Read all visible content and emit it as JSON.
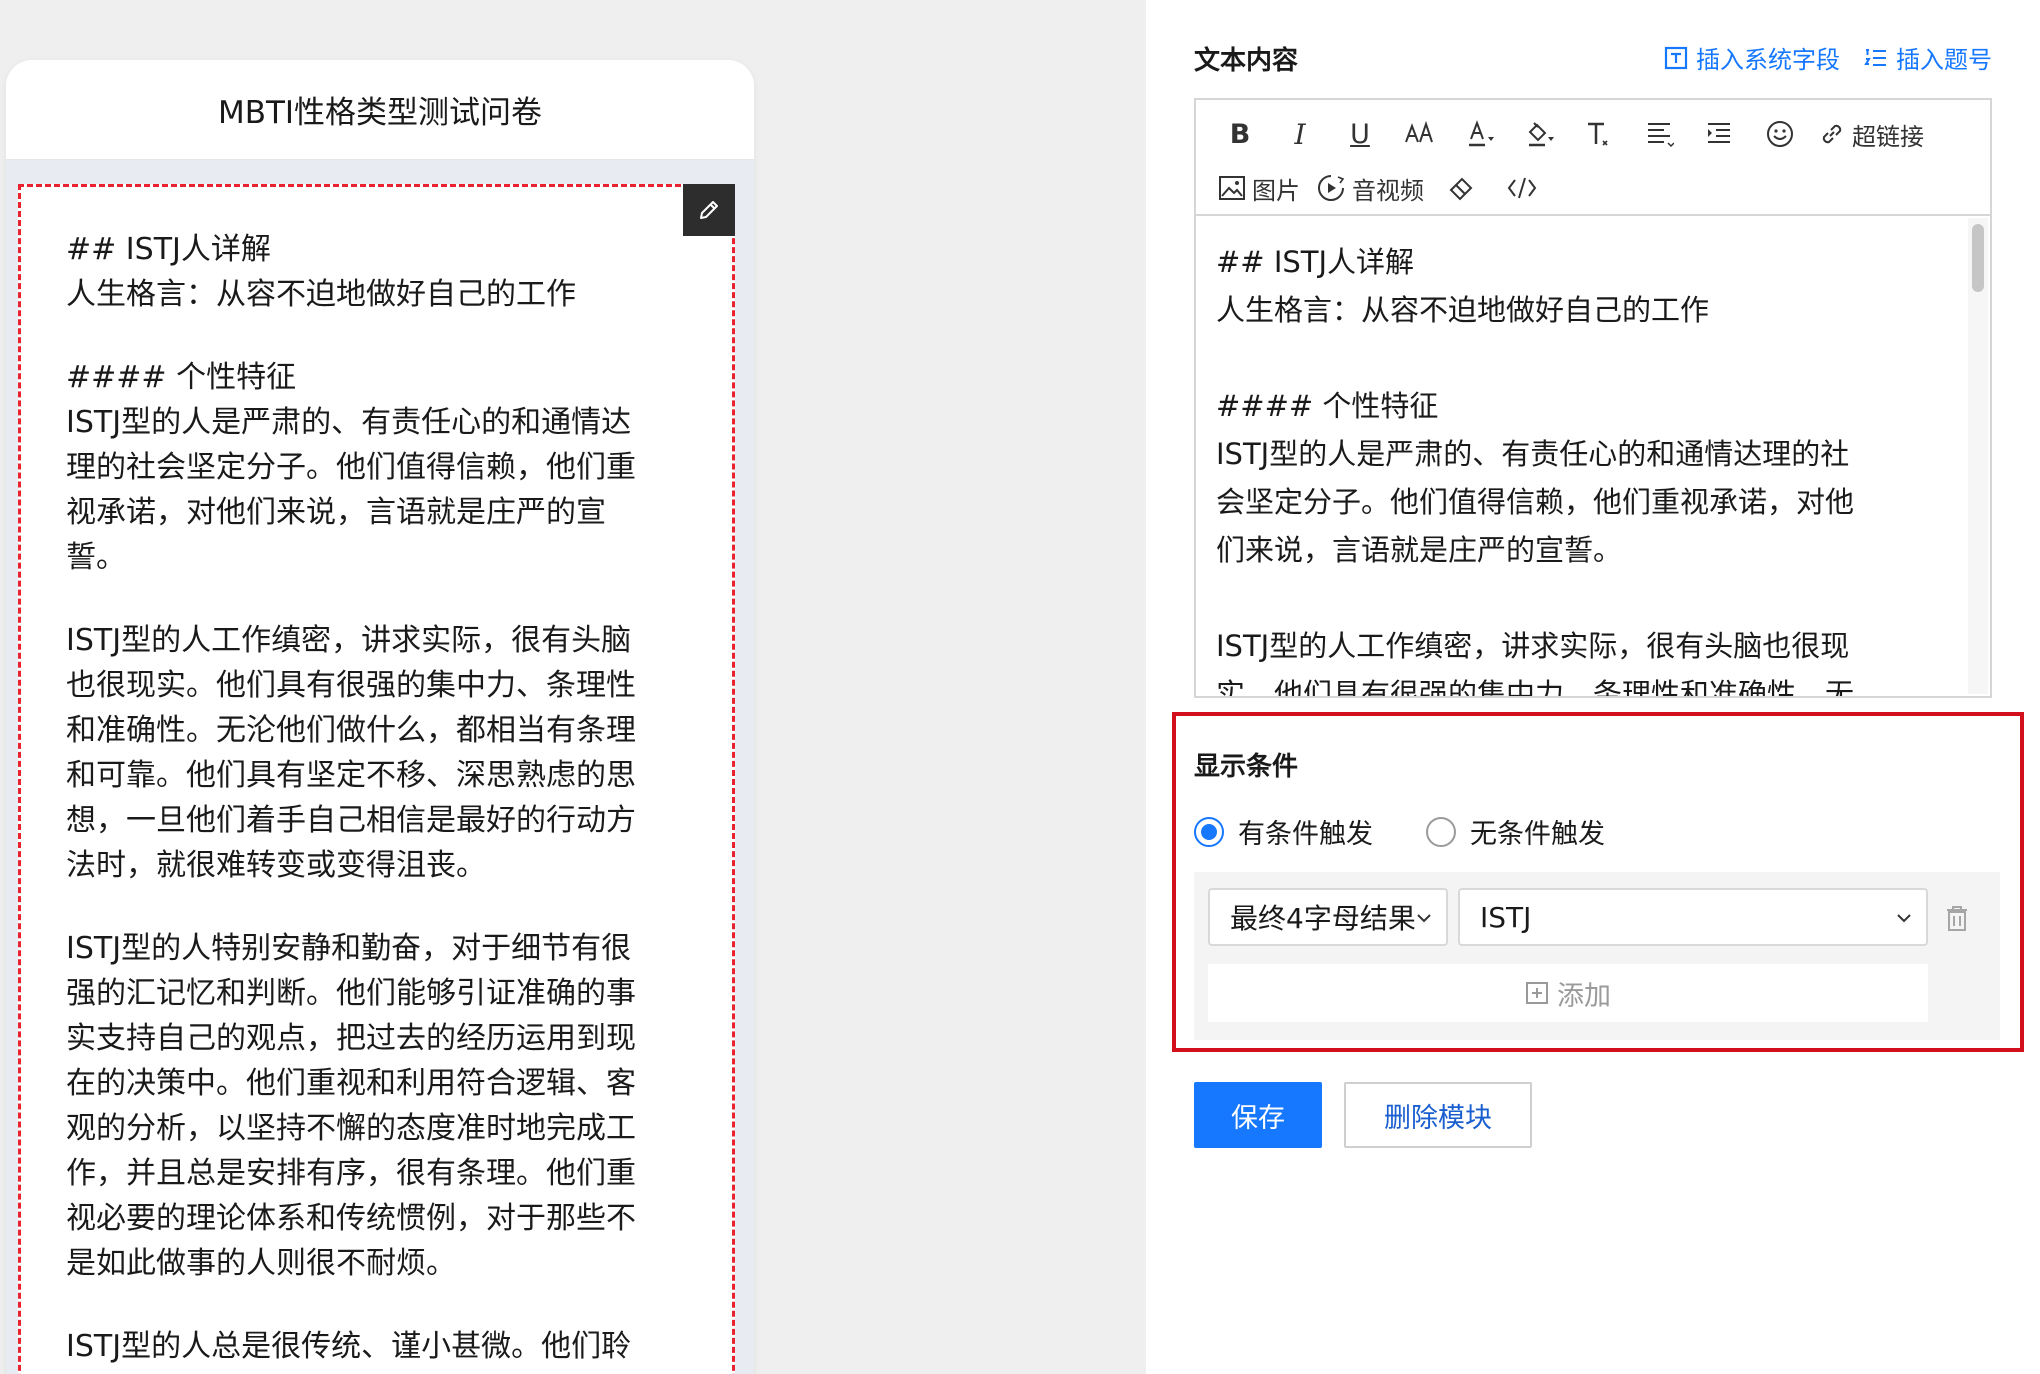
{
  "preview": {
    "title": "MBTI性格类型测试问卷",
    "module_paragraphs": [
      [
        "## ISTJ人详解",
        "人生格言：从容不迫地做好自己的工作"
      ],
      [
        "#### 个性特征",
        "ISTJ型的人是严肃的、有责任心的和通情达",
        "理的社会坚定分子。他们值得信赖，他们重",
        "视承诺，对他们来说，言语就是庄严的宣",
        "誓。"
      ],
      [
        "ISTJ型的人工作缜密，讲求实际，很有头脑",
        "也很现实。他们具有很强的集中力、条理性",
        "和准确性。无沦他们做什么，都相当有条理",
        "和可靠。他们具有坚定不移、深思熟虑的思",
        "想，一旦他们着手自己相信是最好的行动方",
        "法时，就很难转变或变得沮丧。"
      ],
      [
        "ISTJ型的人特别安静和勤奋，对于细节有很",
        "强的汇记忆和判断。他们能够引证准确的事",
        "实支持自己的观点，把过去的经历运用到现",
        "在的决策中。他们重视和利用符合逻辑、客",
        "观的分析，以坚持不懈的态度准时地完成工",
        "作，并且总是安排有序，很有条理。他们重",
        "视必要的理论体系和传统惯例，对于那些不",
        "是如此做事的人则很不耐烦。"
      ],
      [
        "ISTJ型的人总是很传统、谨小甚微。他们聆"
      ]
    ]
  },
  "editor": {
    "section_label": "文本内容",
    "insert_system_field": "插入系统字段",
    "insert_question_no": "插入题号",
    "toolbar": {
      "bold": "B",
      "italic": "I",
      "underline": "U",
      "hyperlink": "超链接",
      "image": "图片",
      "audio_video": "音视频"
    },
    "content_paragraphs": [
      [
        "## ISTJ人详解",
        "人生格言：从容不迫地做好自己的工作"
      ],
      [
        "#### 个性特征",
        "ISTJ型的人是严肃的、有责任心的和通情达理的社",
        "会坚定分子。他们值得信赖，他们重视承诺，对他",
        "们来说，言语就是庄严的宣誓。"
      ],
      [
        "ISTJ型的人工作缜密，讲求实际，很有头脑也很现",
        "实。他们具有很强的集中力、条理性和准确性。无"
      ]
    ]
  },
  "condition": {
    "title": "显示条件",
    "option_conditional": "有条件触发",
    "option_unconditional": "无条件触发",
    "selected": "conditional",
    "field_select_value": "最终4字母结果",
    "value_select_value": "ISTJ",
    "add_label": "添加"
  },
  "actions": {
    "save": "保存",
    "delete_module": "删除模块"
  },
  "colors": {
    "accent": "#1677ff",
    "highlight_border": "#d2101c",
    "module_dash": "#e8232f"
  }
}
